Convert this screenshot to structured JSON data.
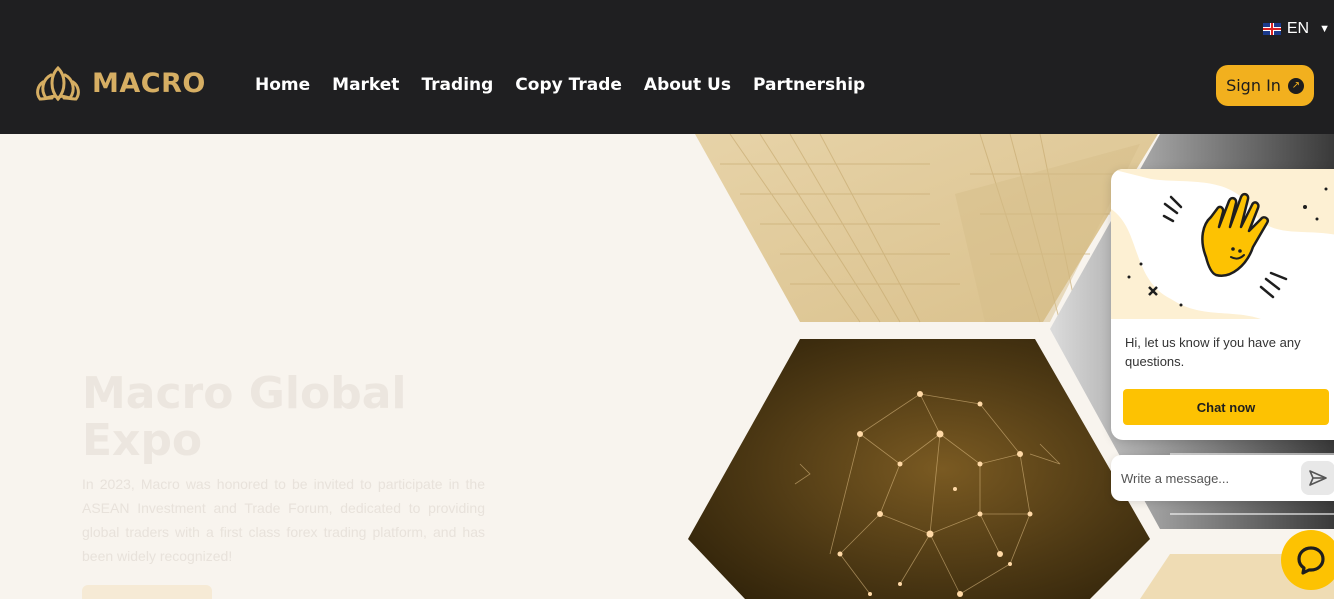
{
  "header": {
    "brand": "MACRO",
    "language": "EN",
    "nav": [
      "Home",
      "Market",
      "Trading",
      "Copy Trade",
      "About Us",
      "Partnership"
    ],
    "sign_in": "Sign In"
  },
  "hero": {
    "title": "Macro Global Expo",
    "description": "In 2023, Macro was honored to be invited to participate in the ASEAN Investment and Trade Forum, dedicated to providing global traders with a first class forex trading platform, and has been widely recognized!"
  },
  "chat": {
    "message": "Hi, let us know if you have any questions.",
    "button": "Chat now",
    "input_placeholder": "Write a message..."
  },
  "colors": {
    "header_bg": "#1f1f21",
    "brand_gold": "#d6ae63",
    "accent": "#f2b01e",
    "chat_yellow": "#fdc202",
    "page_bg": "#f8f4ee"
  }
}
